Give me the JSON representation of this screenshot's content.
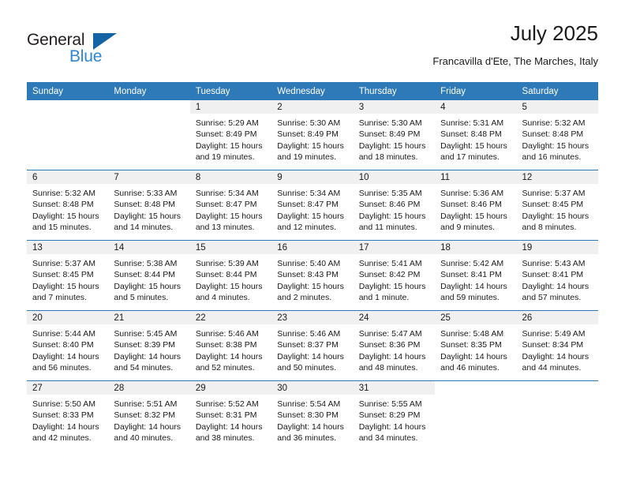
{
  "brand": {
    "name_top": "General",
    "name_bottom": "Blue",
    "triangle_color": "#1464a5",
    "blue_text_color": "#2e86d6"
  },
  "header": {
    "title": "July 2025",
    "subtitle": "Francavilla d'Ete, The Marches, Italy"
  },
  "theme": {
    "header_blue": "#2e7ab8",
    "daynum_band": "#f0f0f0",
    "text": "#1a1a1a"
  },
  "calendar": {
    "weekday_headers": [
      "Sunday",
      "Monday",
      "Tuesday",
      "Wednesday",
      "Thursday",
      "Friday",
      "Saturday"
    ],
    "weeks": [
      [
        {
          "day": "",
          "sunrise": "",
          "sunset": "",
          "daylight1": "",
          "daylight2": "",
          "blank": true
        },
        {
          "day": "",
          "sunrise": "",
          "sunset": "",
          "daylight1": "",
          "daylight2": "",
          "blank": true
        },
        {
          "day": "1",
          "sunrise": "Sunrise: 5:29 AM",
          "sunset": "Sunset: 8:49 PM",
          "daylight1": "Daylight: 15 hours",
          "daylight2": "and 19 minutes."
        },
        {
          "day": "2",
          "sunrise": "Sunrise: 5:30 AM",
          "sunset": "Sunset: 8:49 PM",
          "daylight1": "Daylight: 15 hours",
          "daylight2": "and 19 minutes."
        },
        {
          "day": "3",
          "sunrise": "Sunrise: 5:30 AM",
          "sunset": "Sunset: 8:49 PM",
          "daylight1": "Daylight: 15 hours",
          "daylight2": "and 18 minutes."
        },
        {
          "day": "4",
          "sunrise": "Sunrise: 5:31 AM",
          "sunset": "Sunset: 8:48 PM",
          "daylight1": "Daylight: 15 hours",
          "daylight2": "and 17 minutes."
        },
        {
          "day": "5",
          "sunrise": "Sunrise: 5:32 AM",
          "sunset": "Sunset: 8:48 PM",
          "daylight1": "Daylight: 15 hours",
          "daylight2": "and 16 minutes."
        }
      ],
      [
        {
          "day": "6",
          "sunrise": "Sunrise: 5:32 AM",
          "sunset": "Sunset: 8:48 PM",
          "daylight1": "Daylight: 15 hours",
          "daylight2": "and 15 minutes."
        },
        {
          "day": "7",
          "sunrise": "Sunrise: 5:33 AM",
          "sunset": "Sunset: 8:48 PM",
          "daylight1": "Daylight: 15 hours",
          "daylight2": "and 14 minutes."
        },
        {
          "day": "8",
          "sunrise": "Sunrise: 5:34 AM",
          "sunset": "Sunset: 8:47 PM",
          "daylight1": "Daylight: 15 hours",
          "daylight2": "and 13 minutes."
        },
        {
          "day": "9",
          "sunrise": "Sunrise: 5:34 AM",
          "sunset": "Sunset: 8:47 PM",
          "daylight1": "Daylight: 15 hours",
          "daylight2": "and 12 minutes."
        },
        {
          "day": "10",
          "sunrise": "Sunrise: 5:35 AM",
          "sunset": "Sunset: 8:46 PM",
          "daylight1": "Daylight: 15 hours",
          "daylight2": "and 11 minutes."
        },
        {
          "day": "11",
          "sunrise": "Sunrise: 5:36 AM",
          "sunset": "Sunset: 8:46 PM",
          "daylight1": "Daylight: 15 hours",
          "daylight2": "and 9 minutes."
        },
        {
          "day": "12",
          "sunrise": "Sunrise: 5:37 AM",
          "sunset": "Sunset: 8:45 PM",
          "daylight1": "Daylight: 15 hours",
          "daylight2": "and 8 minutes."
        }
      ],
      [
        {
          "day": "13",
          "sunrise": "Sunrise: 5:37 AM",
          "sunset": "Sunset: 8:45 PM",
          "daylight1": "Daylight: 15 hours",
          "daylight2": "and 7 minutes."
        },
        {
          "day": "14",
          "sunrise": "Sunrise: 5:38 AM",
          "sunset": "Sunset: 8:44 PM",
          "daylight1": "Daylight: 15 hours",
          "daylight2": "and 5 minutes."
        },
        {
          "day": "15",
          "sunrise": "Sunrise: 5:39 AM",
          "sunset": "Sunset: 8:44 PM",
          "daylight1": "Daylight: 15 hours",
          "daylight2": "and 4 minutes."
        },
        {
          "day": "16",
          "sunrise": "Sunrise: 5:40 AM",
          "sunset": "Sunset: 8:43 PM",
          "daylight1": "Daylight: 15 hours",
          "daylight2": "and 2 minutes."
        },
        {
          "day": "17",
          "sunrise": "Sunrise: 5:41 AM",
          "sunset": "Sunset: 8:42 PM",
          "daylight1": "Daylight: 15 hours",
          "daylight2": "and 1 minute."
        },
        {
          "day": "18",
          "sunrise": "Sunrise: 5:42 AM",
          "sunset": "Sunset: 8:41 PM",
          "daylight1": "Daylight: 14 hours",
          "daylight2": "and 59 minutes."
        },
        {
          "day": "19",
          "sunrise": "Sunrise: 5:43 AM",
          "sunset": "Sunset: 8:41 PM",
          "daylight1": "Daylight: 14 hours",
          "daylight2": "and 57 minutes."
        }
      ],
      [
        {
          "day": "20",
          "sunrise": "Sunrise: 5:44 AM",
          "sunset": "Sunset: 8:40 PM",
          "daylight1": "Daylight: 14 hours",
          "daylight2": "and 56 minutes."
        },
        {
          "day": "21",
          "sunrise": "Sunrise: 5:45 AM",
          "sunset": "Sunset: 8:39 PM",
          "daylight1": "Daylight: 14 hours",
          "daylight2": "and 54 minutes."
        },
        {
          "day": "22",
          "sunrise": "Sunrise: 5:46 AM",
          "sunset": "Sunset: 8:38 PM",
          "daylight1": "Daylight: 14 hours",
          "daylight2": "and 52 minutes."
        },
        {
          "day": "23",
          "sunrise": "Sunrise: 5:46 AM",
          "sunset": "Sunset: 8:37 PM",
          "daylight1": "Daylight: 14 hours",
          "daylight2": "and 50 minutes."
        },
        {
          "day": "24",
          "sunrise": "Sunrise: 5:47 AM",
          "sunset": "Sunset: 8:36 PM",
          "daylight1": "Daylight: 14 hours",
          "daylight2": "and 48 minutes."
        },
        {
          "day": "25",
          "sunrise": "Sunrise: 5:48 AM",
          "sunset": "Sunset: 8:35 PM",
          "daylight1": "Daylight: 14 hours",
          "daylight2": "and 46 minutes."
        },
        {
          "day": "26",
          "sunrise": "Sunrise: 5:49 AM",
          "sunset": "Sunset: 8:34 PM",
          "daylight1": "Daylight: 14 hours",
          "daylight2": "and 44 minutes."
        }
      ],
      [
        {
          "day": "27",
          "sunrise": "Sunrise: 5:50 AM",
          "sunset": "Sunset: 8:33 PM",
          "daylight1": "Daylight: 14 hours",
          "daylight2": "and 42 minutes."
        },
        {
          "day": "28",
          "sunrise": "Sunrise: 5:51 AM",
          "sunset": "Sunset: 8:32 PM",
          "daylight1": "Daylight: 14 hours",
          "daylight2": "and 40 minutes."
        },
        {
          "day": "29",
          "sunrise": "Sunrise: 5:52 AM",
          "sunset": "Sunset: 8:31 PM",
          "daylight1": "Daylight: 14 hours",
          "daylight2": "and 38 minutes."
        },
        {
          "day": "30",
          "sunrise": "Sunrise: 5:54 AM",
          "sunset": "Sunset: 8:30 PM",
          "daylight1": "Daylight: 14 hours",
          "daylight2": "and 36 minutes."
        },
        {
          "day": "31",
          "sunrise": "Sunrise: 5:55 AM",
          "sunset": "Sunset: 8:29 PM",
          "daylight1": "Daylight: 14 hours",
          "daylight2": "and 34 minutes."
        },
        {
          "day": "",
          "sunrise": "",
          "sunset": "",
          "daylight1": "",
          "daylight2": "",
          "blank": true
        },
        {
          "day": "",
          "sunrise": "",
          "sunset": "",
          "daylight1": "",
          "daylight2": "",
          "blank": true
        }
      ]
    ]
  }
}
